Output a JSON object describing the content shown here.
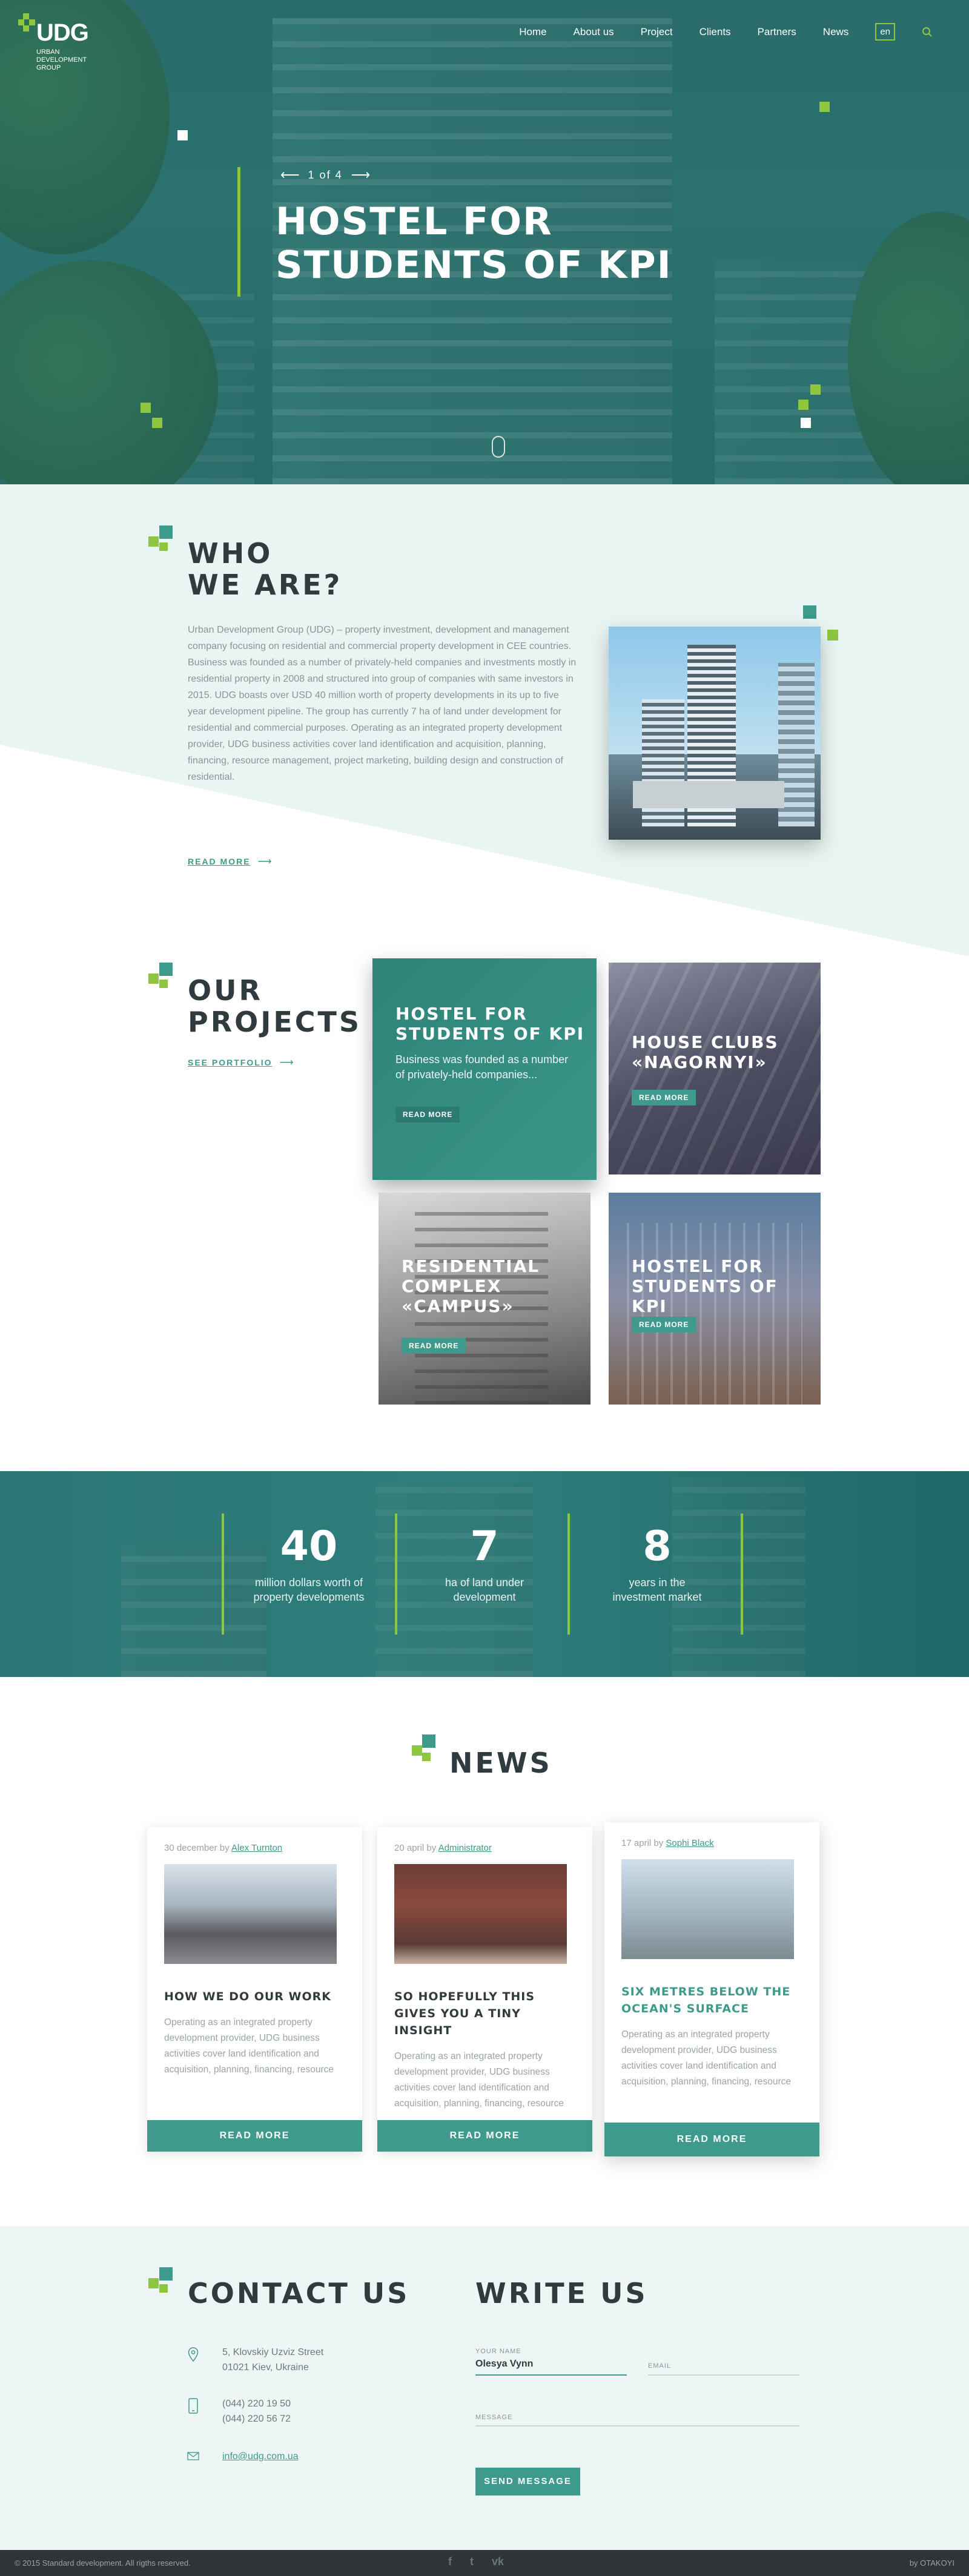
{
  "header": {
    "logo_text": "UDG",
    "logo_sub": "URBAN DEVELOPMENT GROUP",
    "nav": [
      "Home",
      "About us",
      "Project",
      "Clients",
      "Partners",
      "News"
    ],
    "lang": "en",
    "search_icon": "search-icon"
  },
  "hero": {
    "pager": "1 of 4",
    "title": "HOSTEL FOR STUDENTS OF KPI"
  },
  "who": {
    "title_line1": "WHO",
    "title_line2": "WE ARE?",
    "text": "Urban Development Group (UDG) – property investment, development and management company focusing on residential and commercial property development in CEE countries. Business was founded as a number of privately-held companies and investments mostly in residential property in 2008 and structured into group of companies with same investors in 2015. UDG boasts over USD 40 million worth of property developments in its up to five year development pipeline. The group has currently 7 ha of land under development for residential and commercial purposes. Operating as an integrated property development provider, UDG business activities cover land identification and acquisition, planning, financing, resource management, project marketing, building design and construction of residential.",
    "read_more": "READ MORE"
  },
  "projects": {
    "title_line1": "OUR",
    "title_line2": "PROJECTS",
    "portfolio": "SEE PORTFOLIO",
    "items": [
      {
        "title": "HOSTEL FOR STUDENTS OF KPI",
        "desc": "Business was founded as a number of privately-held companies...",
        "btn": "READ MORE"
      },
      {
        "title": "HOUSE CLUBS «NAGORNYI»",
        "btn": "READ MORE"
      },
      {
        "title": "RESIDENTIAL COMPLEX «CAMPUS»",
        "btn": "READ MORE"
      },
      {
        "title": "HOSTEL FOR STUDENTS OF KPI",
        "btn": "READ MORE"
      }
    ]
  },
  "stats": [
    {
      "num": "40",
      "label": "million dollars worth of property developments"
    },
    {
      "num": "7",
      "label": "ha of land under development"
    },
    {
      "num": "8",
      "label": "years in the investment market"
    }
  ],
  "news": {
    "title": "NEWS",
    "items": [
      {
        "date": "30 december",
        "by": "by",
        "author": "Alex Turnton",
        "title": "HOW WE DO OUR WORK",
        "text": "Operating as an integrated property development provider, UDG business activities cover land identification and acquisition, planning, financing, resource",
        "btn": "READ MORE"
      },
      {
        "date": "20 april",
        "by": "by",
        "author": "Administrator",
        "title": "SO HOPEFULLY THIS GIVES YOU A TINY INSIGHT",
        "text": "Operating as an integrated property development provider, UDG business activities cover land identification and acquisition, planning, financing, resource",
        "btn": "READ MORE"
      },
      {
        "date": "17 april",
        "by": "by",
        "author": "Sophi Black",
        "title": "SIX METRES BELOW THE OCEAN'S SURFACE",
        "text": "Operating as an integrated property development provider, UDG business activities cover land identification and acquisition, planning, financing, resource",
        "btn": "READ MORE"
      }
    ]
  },
  "contact": {
    "title": "CONTACT US",
    "address1": "5, Klovskiy Uzviz Street",
    "address2": "01021 Kiev, Ukraine",
    "phone1": "(044) 220 19 50",
    "phone2": "(044) 220 56 72",
    "email": "info@udg.com.ua"
  },
  "write": {
    "title": "WRITE US",
    "name_label": "YOUR NAME",
    "name_value": "Olesya Vynn",
    "email_placeholder": "EMAIL",
    "message_placeholder": "MESSAGE",
    "send": "SEND MESSAGE"
  },
  "footer": {
    "copyright": "© 2015 Standard development. All rigths reserved.",
    "social": [
      "f",
      "t",
      "vk"
    ],
    "by": "by OTAKOYI"
  },
  "colors": {
    "teal": "#3e9a8c",
    "green": "#8ec63f",
    "dark": "#2e3437"
  }
}
